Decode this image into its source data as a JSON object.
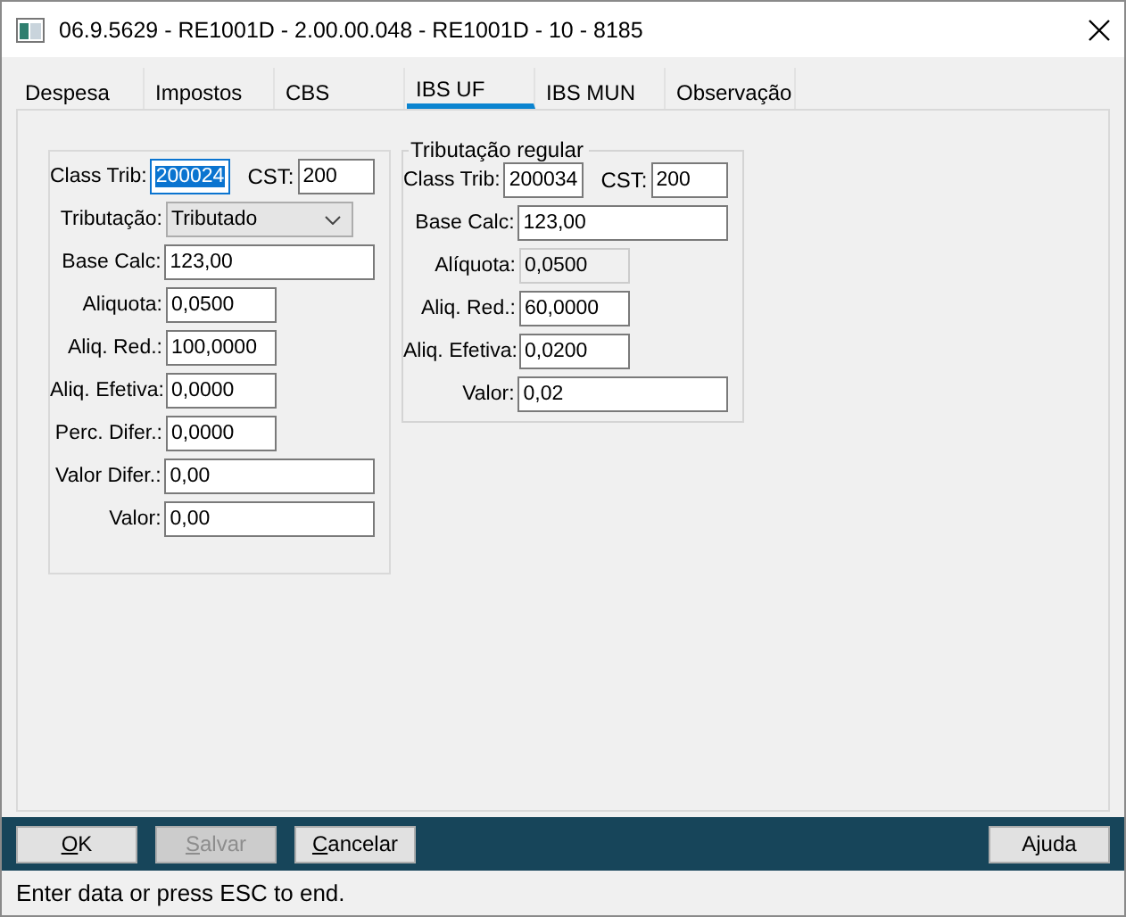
{
  "window": {
    "title": "06.9.5629 - RE1001D - 2.00.00.048 - RE1001D - 10 - 8185"
  },
  "tabs": [
    {
      "label": "Despesa",
      "selected": false
    },
    {
      "label": "Impostos",
      "selected": false
    },
    {
      "label": "CBS",
      "selected": false
    },
    {
      "label": "IBS UF",
      "selected": true
    },
    {
      "label": "IBS MUN",
      "selected": false
    },
    {
      "label": "Observação",
      "selected": false
    }
  ],
  "groups": [
    {
      "rows": [
        {
          "label": "Class Trib:",
          "kind": "short",
          "value": "200024",
          "focused": true,
          "extra": {
            "label": "CST:",
            "value": "200"
          }
        },
        {
          "label": "Tributação:",
          "kind": "select",
          "value": "Tributado"
        },
        {
          "label": "Base Calc:",
          "kind": "wide",
          "value": "123,00"
        },
        {
          "label": "Aliquota:",
          "kind": "medium",
          "value": "0,0500"
        },
        {
          "label": "Aliq. Red.:",
          "kind": "medium",
          "value": "100,0000"
        },
        {
          "label": "Aliq. Efetiva:",
          "kind": "medium",
          "value": "0,0000"
        },
        {
          "label": "Perc. Difer.:",
          "kind": "medium",
          "value": "0,0000"
        },
        {
          "label": "Valor Difer.:",
          "kind": "wide",
          "value": "0,00"
        },
        {
          "label": "Valor:",
          "kind": "wide",
          "value": "0,00"
        }
      ]
    },
    {
      "title": "Tributação regular",
      "rows": [
        {
          "label": "Class Trib:",
          "kind": "short",
          "value": "200034",
          "extra": {
            "label": "CST:",
            "value": "200"
          }
        },
        {
          "label": "Base Calc:",
          "kind": "wide",
          "value": "123,00"
        },
        {
          "label": "Alíquota:",
          "kind": "medium",
          "value": "0,0500",
          "disabled": true
        },
        {
          "label": "Aliq. Red.:",
          "kind": "medium",
          "value": "60,0000"
        },
        {
          "label": "Aliq. Efetiva:",
          "kind": "medium",
          "value": "0,0200"
        },
        {
          "label": "Valor:",
          "kind": "wide",
          "value": "0,02"
        }
      ]
    }
  ],
  "buttons": [
    {
      "label": "OK",
      "mnemonic": true,
      "disabled": false
    },
    {
      "label": "Salvar",
      "mnemonic": true,
      "disabled": true
    },
    {
      "label": "Cancelar",
      "mnemonic": true,
      "disabled": false
    },
    {
      "label": "Ajuda",
      "mnemonic": false,
      "disabled": false
    }
  ],
  "status_bar": "Enter data or press ESC to end."
}
